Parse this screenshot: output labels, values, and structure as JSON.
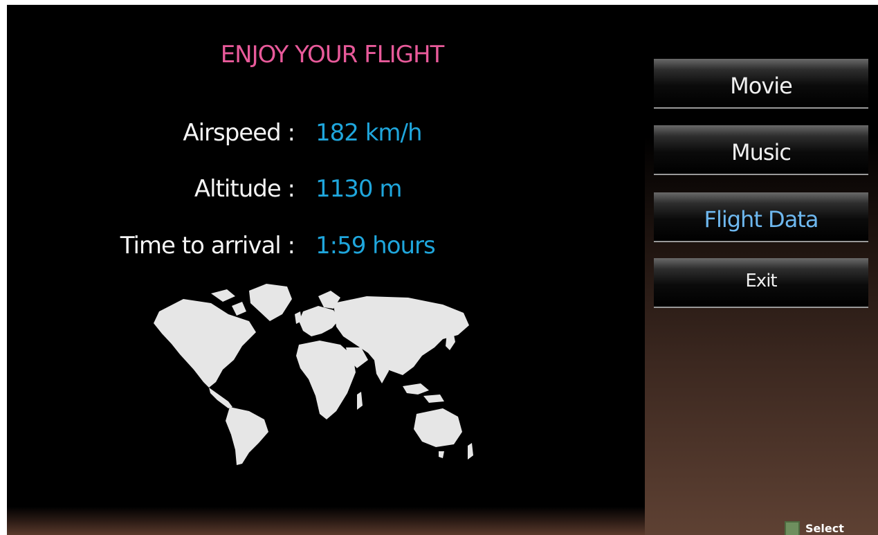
{
  "title": "ENJOY YOUR FLIGHT",
  "flight_info": {
    "airspeed": {
      "label": "Airspeed :",
      "value": "182 km/h"
    },
    "altitude": {
      "label": "Altitude :",
      "value": "1130 m"
    },
    "time_to_arrival": {
      "label": "Time to arrival :",
      "value": "1:59 hours"
    }
  },
  "menu": {
    "movie": "Movie",
    "music": "Music",
    "flight_data": "Flight Data",
    "exit": "Exit",
    "active_item": "flight_data"
  },
  "hint": {
    "select_label": "Select"
  },
  "colors": {
    "title": "#e85a9a",
    "value": "#1fa6dc",
    "active_menu": "#6eb8ef",
    "select_swatch": "#6e8f5e"
  },
  "icons": {
    "map": "world-map-icon",
    "select_key": "select-key-icon"
  }
}
